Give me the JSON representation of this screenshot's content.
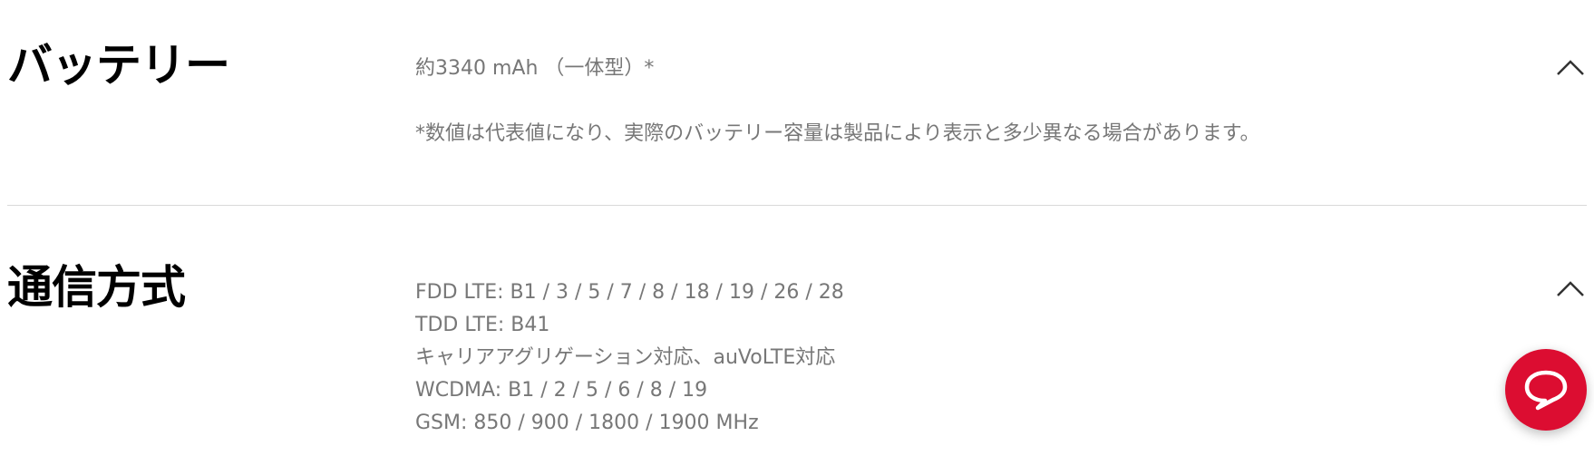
{
  "sections": [
    {
      "title": "バッテリー",
      "lines": [
        "約3340 mAh （一体型）*"
      ],
      "note": "*数値は代表値になり、実際のバッテリー容量は製品により表示と多少異なる場合があります。"
    },
    {
      "title": "通信方式",
      "lines": [
        "FDD LTE: B1 / 3 / 5 / 7 / 8 / 18 / 19 / 26 / 28",
        "TDD LTE: B41",
        "キャリアアグリゲーション対応、auVoLTE対応",
        "WCDMA: B1 / 2 / 5 / 6 / 8 / 19",
        "GSM: 850 / 900 / 1800 / 1900 MHz"
      ]
    }
  ],
  "icons": {
    "toggle": "chevron-up-icon",
    "chat": "chat-bubble-icon"
  },
  "colors": {
    "title": "#000000",
    "body_text": "#777777",
    "divider": "#d9d9d9",
    "chat_button": "#dc0d31"
  }
}
